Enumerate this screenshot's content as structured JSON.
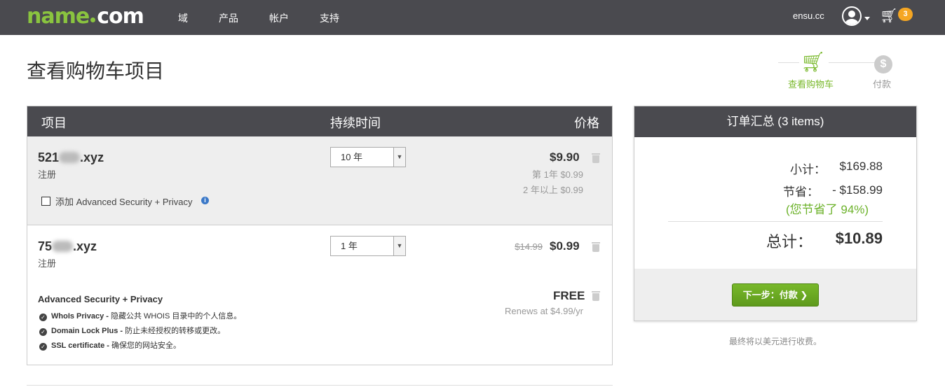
{
  "header": {
    "logo_left": "name",
    "logo_right": "com",
    "nav": [
      "域",
      "产品",
      "帐户",
      "支持"
    ],
    "user": "ensu.cc",
    "cart_count": "3"
  },
  "page": {
    "title": "查看购物车项目"
  },
  "steps": {
    "step1": "查看购物车",
    "step2": "付款",
    "coin_symbol": "$"
  },
  "cart": {
    "headers": {
      "item": "项目",
      "duration": "持续时间",
      "price": "价格"
    },
    "items": [
      {
        "domain_prefix": "521",
        "domain_suffix": ".xyz",
        "type": "注册",
        "duration": "10 年",
        "price": "$9.90",
        "note1": "第 1年 $0.99",
        "note2": "2 年以上 $0.99",
        "addon_label": "添加 Advanced Security + Privacy"
      },
      {
        "domain_prefix": "75",
        "domain_suffix": ".xyz",
        "type": "注册",
        "duration": "1 年",
        "old_price": "$14.99",
        "price": "$0.99"
      }
    ],
    "addon": {
      "title": "Advanced Security + Privacy",
      "price": "FREE",
      "renews": "Renews at $4.99/yr",
      "features": [
        {
          "name": "WhoIs Privacy -",
          "desc": " 隐藏公共 WHOIS 目录中的个人信息。"
        },
        {
          "name": "Domain Lock Plus -",
          "desc": " 防止未经授权的转移或更改。"
        },
        {
          "name": "SSL certificate -",
          "desc": " 确保您的网站安全。"
        }
      ]
    }
  },
  "summary": {
    "title": "订单汇总 (3 items)",
    "subtotal_label": "小计：",
    "subtotal": "$169.88",
    "savings_label": "节省：",
    "savings": "- $158.99",
    "saved_note": "(您节省了 94%)",
    "total_label": "总计：",
    "total": "$10.89",
    "next_button": "下一步：付款 ❯"
  },
  "footer_note": "最终将以美元进行收费。",
  "colors": {
    "header_bg": "#4a4a4f",
    "accent_green": "#78b82a",
    "badge_orange": "#f5a623"
  }
}
